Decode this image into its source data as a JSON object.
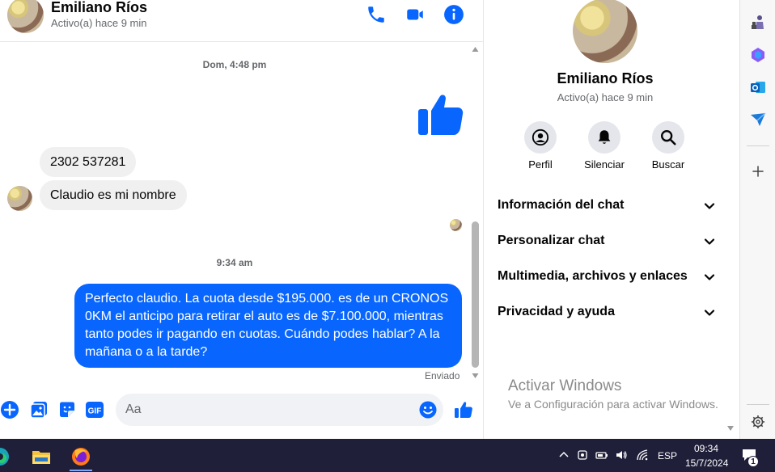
{
  "header": {
    "name": "Emiliano Ríos",
    "status": "Activo(a) hace 9 min",
    "icons": [
      "phone-icon",
      "video-camera-icon",
      "info-icon"
    ]
  },
  "messages": {
    "time1": "Dom, 4:48 pm",
    "incoming1": "2302 537281",
    "incoming2": "Claudio es mi nombre",
    "time2": "9:34 am",
    "outgoing": "Perfecto claudio. La cuota desde $195.000. es de un CRONOS 0KM el anticipo para retirar el auto es de $7.100.000, mientras tanto podes ir pagando en cuotas. Cuándo podes hablar? A la mañana o a la tarde?",
    "sent_status": "Enviado"
  },
  "composer": {
    "placeholder": "Aa",
    "icons": [
      "plus-icon",
      "image-icon",
      "sticker-icon",
      "gif-icon",
      "emoji-icon",
      "like-icon"
    ]
  },
  "info_panel": {
    "name": "Emiliano Ríos",
    "status": "Activo(a) hace 9 min",
    "actions": [
      {
        "label": "Perfil",
        "icon": "profile-icon"
      },
      {
        "label": "Silenciar",
        "icon": "bell-icon"
      },
      {
        "label": "Buscar",
        "icon": "search-icon"
      }
    ],
    "sections": [
      "Información del chat",
      "Personalizar chat",
      "Multimedia, archivos y enlaces",
      "Privacidad y ayuda"
    ],
    "activate_title": "Activar Windows",
    "activate_sub": "Ve a Configuración para activar Windows."
  },
  "taskbar": {
    "language": "ESP",
    "time": "09:34",
    "date": "15/7/2024",
    "notification_count": "1"
  },
  "colors": {
    "accent": "#0866ff",
    "incoming_bubble": "#f0f0f0",
    "taskbar": "#1f1f3a"
  }
}
